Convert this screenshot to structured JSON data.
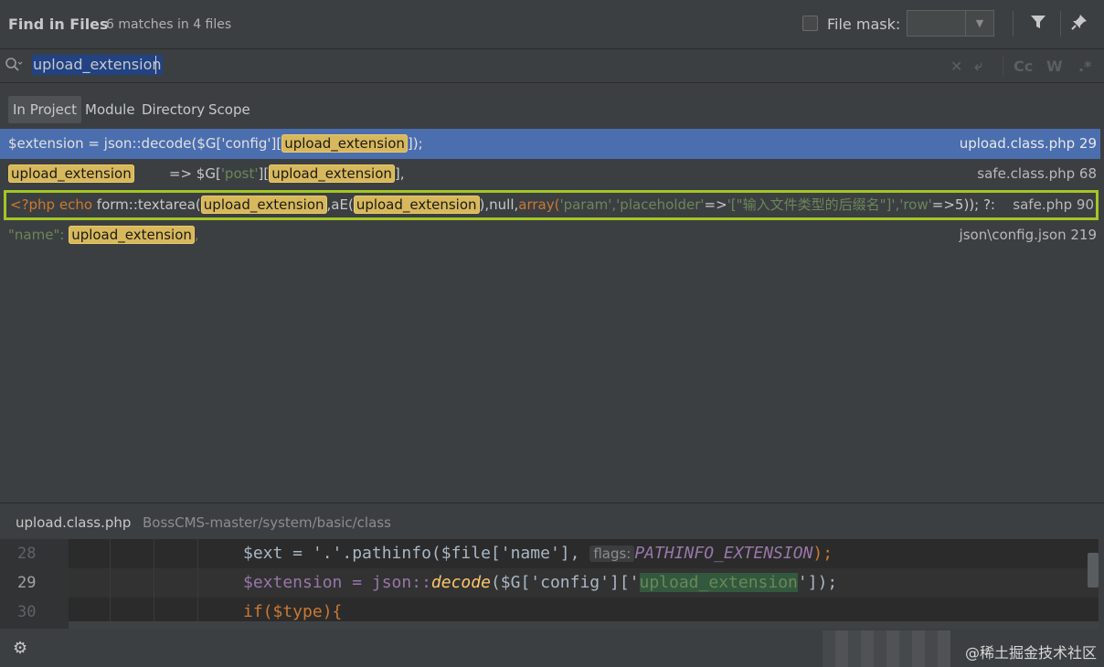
{
  "header": {
    "title": "Find in Files",
    "subtitle": "6 matches in 4 files",
    "file_mask_label": "File mask:",
    "file_mask_value": "",
    "filter_icon": "filter-icon",
    "pin_icon": "pin-icon"
  },
  "search": {
    "query": "upload_extension",
    "icons": [
      "search-icon",
      "clear-icon",
      "newline-icon",
      "match-case-icon",
      "words-icon",
      "regex-icon"
    ],
    "match_case_label": "Cc",
    "words_label": "W",
    "regex_label": ".*"
  },
  "scope_tabs": [
    {
      "label": "In Project",
      "active": true
    },
    {
      "label": "Module",
      "active": false
    },
    {
      "label": "Directory",
      "active": false
    },
    {
      "label": "Scope",
      "active": false
    }
  ],
  "results": [
    {
      "file": "upload.class.php 29",
      "selected": true,
      "parts": {
        "a": "$extension = json::decode($G['config'][",
        "hl": "upload_extension",
        "b": "]);"
      }
    },
    {
      "file": "safe.class.php 68",
      "parts": {
        "hl1": "upload_extension",
        "a": "=> $G[",
        "str1": "'post'",
        "b": "][",
        "hl2": "upload_extension",
        "c": "],"
      }
    },
    {
      "file": "safe.php 90",
      "outlined": true,
      "parts": {
        "a": "<?php echo",
        "b": "form::textarea(",
        "hl1": "upload_extension",
        "c": ",aE(",
        "hl2": "upload_extension",
        "d": "),null,",
        "e": "array(",
        "f": "'param','placeholder'",
        "g": "=>",
        "h": "'[\"输入文件类型的后缀名\"]'",
        "i": ",'row'",
        "j": "=>5)); ?:"
      }
    },
    {
      "file": "json\\config.json 219",
      "parts": {
        "a": "\"name\":",
        "hl": "upload_extension",
        "b": ","
      }
    }
  ],
  "preview": {
    "file_name": "upload.class.php",
    "path": "BossCMS-master/system/basic/class",
    "lines": [
      {
        "number": "28",
        "code_a": "$ext = '.'.pathinfo($file['name'],",
        "hint": "flags:",
        "code_b": "PATHINFO_EXTENSION",
        "code_c": ");"
      },
      {
        "number": "29",
        "code_a": "$extension = json::",
        "fn": "decode",
        "code_b": "($G['config']['",
        "hl": "upload_extension",
        "code_c": "']);"
      },
      {
        "number": "30",
        "code_a": "if($type){"
      }
    ]
  },
  "footer": {
    "settings_icon": "gear-icon",
    "watermark": "@稀土掘金技术社区"
  },
  "colors": {
    "background": "#3c3f41",
    "selection": "#4b6eaf",
    "highlight": "#d8b85c",
    "outline": "#a2c724",
    "editor_bg": "#2b2b2b"
  }
}
